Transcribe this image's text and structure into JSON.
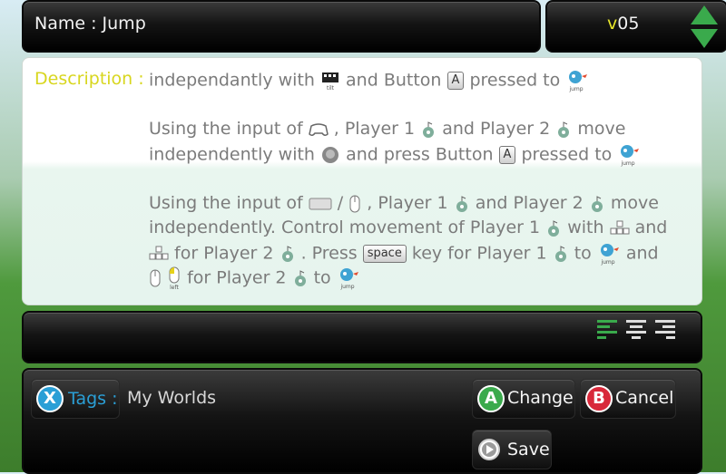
{
  "header": {
    "name_label": "Name : Jump",
    "version_prefix": "v",
    "version_number": "05"
  },
  "description": {
    "label": "Description :",
    "lines": [
      {
        "parts": [
          "independantly with ",
          " and Button ",
          " pressed to "
        ]
      },
      {
        "parts": [
          "Using the input of ",
          ", Player 1 ",
          "and Player 2 ",
          "move"
        ]
      },
      {
        "parts": [
          "independently with ",
          " and press Button ",
          " pressed to "
        ]
      },
      {
        "parts": [
          "Using the input of ",
          " / ",
          ", Player 1 ",
          "and Player 2 ",
          "move"
        ]
      },
      {
        "parts": [
          "independently. Control movement of Player 1 ",
          " with ",
          " and"
        ]
      },
      {
        "parts": [
          " for Player 2 ",
          ". Press ",
          " key for Player 1 ",
          " to ",
          " and"
        ]
      },
      {
        "parts": [
          " ",
          " for Player 2 ",
          " to "
        ]
      }
    ],
    "icon_labels": {
      "tilt": "tilt",
      "jump": "jump",
      "left": "left"
    },
    "button_a": "A",
    "space_key": "space"
  },
  "tags": {
    "badge": "X",
    "label": "Tags :",
    "value": "My Worlds"
  },
  "buttons": {
    "change_badge": "A",
    "change": "Change",
    "cancel_badge": "B",
    "cancel": "Cancel",
    "save": "Save"
  },
  "colors": {
    "accent_green": "#3aaa4c",
    "label_yellow": "#d8d61e",
    "tag_blue": "#2a9fd6",
    "cancel_red": "#d8283a"
  }
}
